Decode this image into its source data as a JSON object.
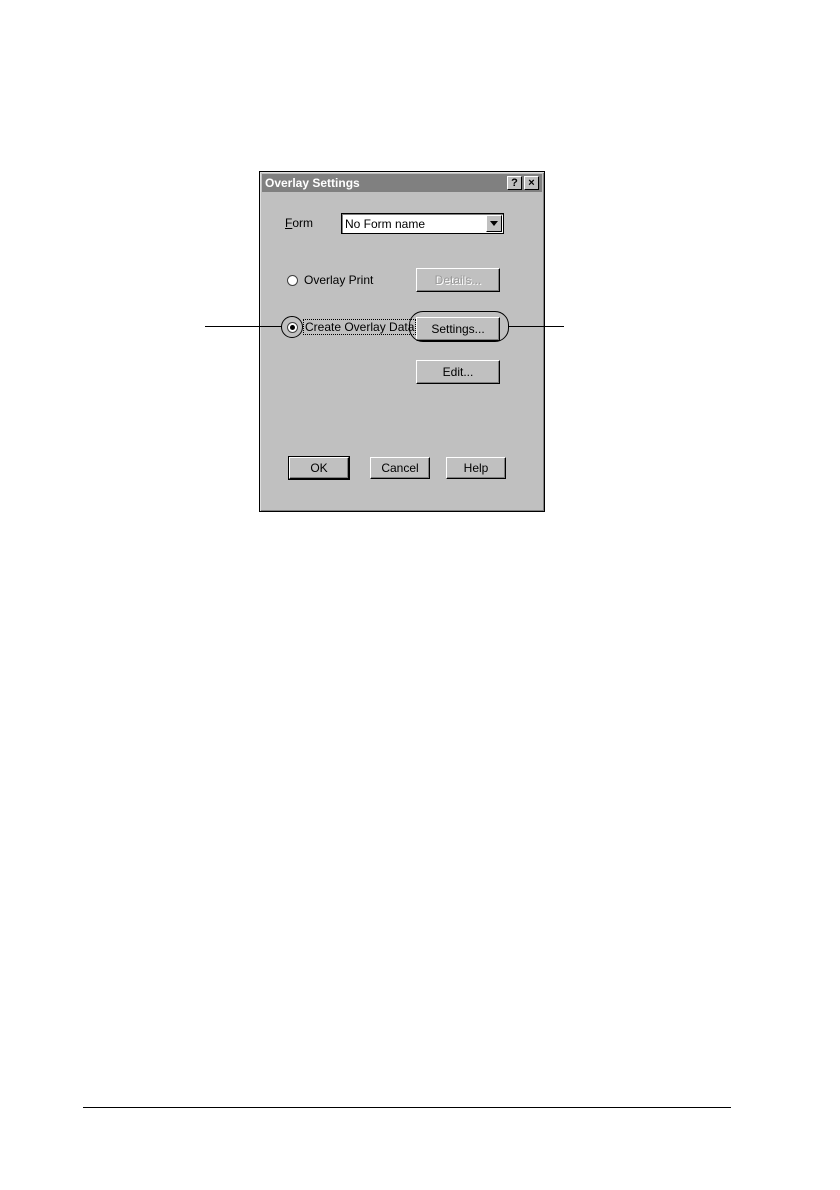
{
  "window": {
    "title": "Overlay Settings",
    "help_glyph": "?",
    "close_glyph": "×"
  },
  "form": {
    "label": "Form",
    "selected": "No Form name"
  },
  "options": {
    "overlay_print": {
      "label": "Overlay Print",
      "checked": false
    },
    "create_overlay_data": {
      "label": "Create Overlay Data",
      "checked": true
    }
  },
  "buttons": {
    "details": "Details...",
    "settings": "Settings...",
    "edit": "Edit...",
    "ok": "OK",
    "cancel": "Cancel",
    "help": "Help"
  },
  "icons": {
    "combo_arrow": "chevron-down-icon",
    "help": "question-icon",
    "close": "close-icon"
  },
  "colors": {
    "dialog_face": "#c0c0c0",
    "title_bar": "#808080",
    "disabled_text": "#9a9a9a"
  }
}
